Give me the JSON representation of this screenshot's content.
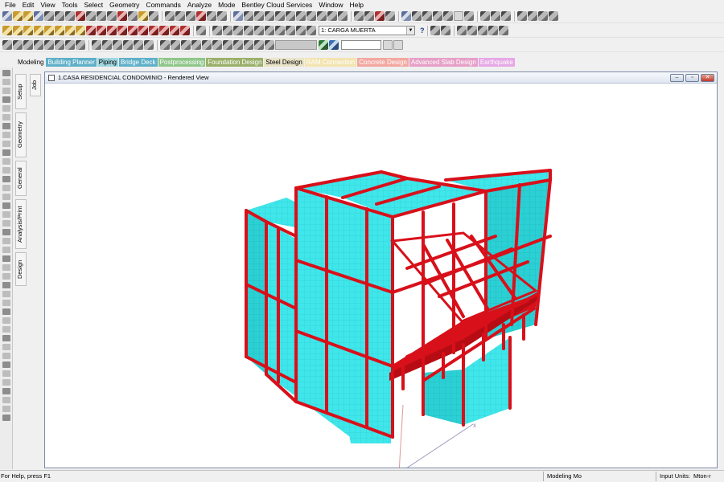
{
  "menu": [
    "File",
    "Edit",
    "View",
    "Tools",
    "Select",
    "Geometry",
    "Commands",
    "Analyze",
    "Mode",
    "Bentley Cloud Services",
    "Window",
    "Help"
  ],
  "toolbar": {
    "load_case": "1: CARGA MUERTA",
    "help_glyph": "?"
  },
  "modules": [
    {
      "label": "Modeling",
      "bg": "#f0f0f0",
      "fg": "#000000"
    },
    {
      "label": "Building Planner",
      "bg": "#5fb0c8",
      "fg": "#ffffff"
    },
    {
      "label": "Piping",
      "bg": "#9fd6e0",
      "fg": "#000000"
    },
    {
      "label": "Bridge Deck",
      "bg": "#5fb0c8",
      "fg": "#ffffff"
    },
    {
      "label": "Postprocessing",
      "bg": "#8fc68a",
      "fg": "#ffffff"
    },
    {
      "label": "Foundation Design",
      "bg": "#9ab06a",
      "fg": "#ffffff"
    },
    {
      "label": "Steel Design",
      "bg": "#e9e4c8",
      "fg": "#000000"
    },
    {
      "label": "RAM Connection",
      "bg": "#f3e4b0",
      "fg": "#ffffff"
    },
    {
      "label": "Concrete Design",
      "bg": "#f2a8a0",
      "fg": "#ffffff"
    },
    {
      "label": "Advanced Slab Design",
      "bg": "#e6a0c8",
      "fg": "#ffffff"
    },
    {
      "label": "Earthquake",
      "bg": "#e6a8e6",
      "fg": "#ffffff"
    }
  ],
  "side_tabs": {
    "job": "Job",
    "setup": "Setup",
    "geometry": "Geometry",
    "general": "General",
    "analysis": "Analysis/Print",
    "design": "Design"
  },
  "window": {
    "title": "1.CASA RESIDENCIAL CONDOMINIO - Rendered View",
    "minimize": "–",
    "restore": "▫",
    "close": "✕"
  },
  "axes": {
    "x": "x"
  },
  "colors": {
    "panel": "#3fe6ea",
    "panel_dark": "#22b4b8",
    "frame": "#d8101a",
    "frame_dark": "#9a0a10"
  },
  "status": {
    "help": "For Help, press F1",
    "mode": "Modeling Mo",
    "units_label": "Input Units:",
    "units_value": "Mton-r"
  }
}
